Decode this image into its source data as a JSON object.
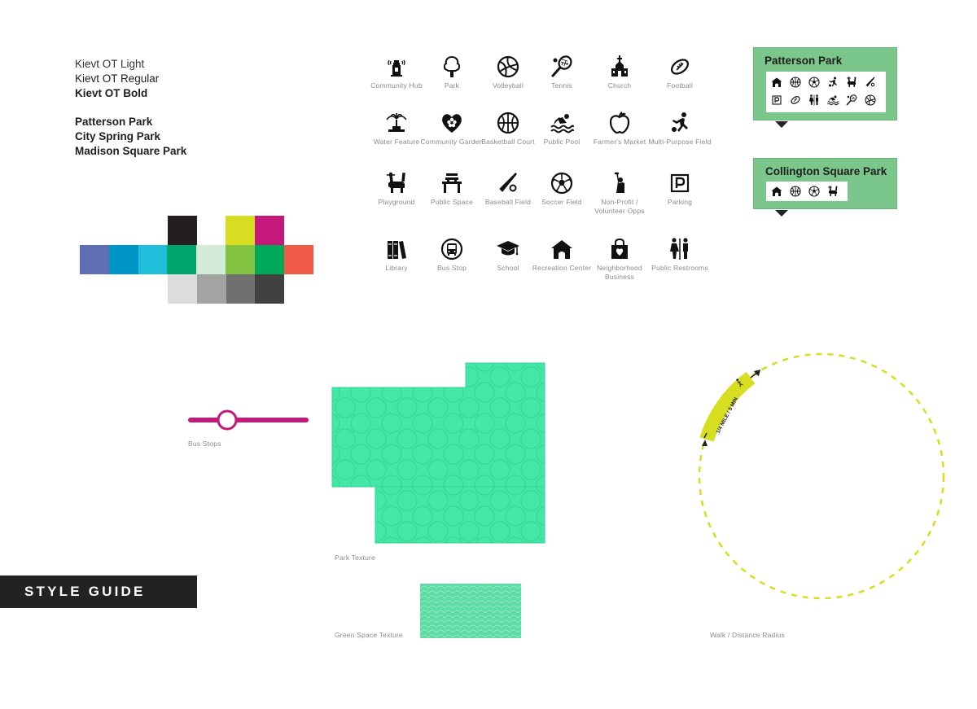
{
  "typography": {
    "light": "Kievt OT Light",
    "regular": "Kievt OT Regular",
    "bold": "Kievt OT Bold"
  },
  "park_names": [
    "Patterson Park",
    "City Spring Park",
    "Madison Square Park"
  ],
  "palette": {
    "row_top": [
      "#231f20",
      "#d7de21",
      "#c4197b"
    ],
    "row_middle": [
      "#5f6db3",
      "#0095c8",
      "#1fbfdc",
      "#00a56d",
      "#d3ead7",
      "#84c341",
      "#00a859",
      "#f15a46"
    ],
    "row_bottom": [
      "#dcdcdc",
      "#a3a3a3",
      "#707070",
      "#414141"
    ]
  },
  "icons": [
    {
      "name": "community-hub-icon",
      "label": "Community Hub"
    },
    {
      "name": "park-icon",
      "label": "Park"
    },
    {
      "name": "volleyball-icon",
      "label": "Volleyball"
    },
    {
      "name": "tennis-icon",
      "label": "Tennis"
    },
    {
      "name": "church-icon",
      "label": "Church"
    },
    {
      "name": "football-icon",
      "label": "Football"
    },
    {
      "name": "water-feature-icon",
      "label": "Water Feature"
    },
    {
      "name": "community-garden-icon",
      "label": "Community Garden"
    },
    {
      "name": "basketball-court-icon",
      "label": "Basketball Court"
    },
    {
      "name": "public-pool-icon",
      "label": "Public Pool"
    },
    {
      "name": "farmers-market-icon",
      "label": "Farmer's Market"
    },
    {
      "name": "multi-purpose-field-icon",
      "label": "Multi-Purpose Field"
    },
    {
      "name": "playground-icon",
      "label": "Playground"
    },
    {
      "name": "public-space-icon",
      "label": "Public Space"
    },
    {
      "name": "baseball-field-icon",
      "label": "Baseball Field"
    },
    {
      "name": "soccer-field-icon",
      "label": "Soccer Field"
    },
    {
      "name": "non-profit-icon",
      "label": "Non-Profit / Volunteer Opps"
    },
    {
      "name": "parking-icon",
      "label": "Parking"
    },
    {
      "name": "library-icon",
      "label": "Library"
    },
    {
      "name": "bus-stop-icon",
      "label": "Bus Stop"
    },
    {
      "name": "school-icon",
      "label": "School"
    },
    {
      "name": "recreation-center-icon",
      "label": "Recreation Center"
    },
    {
      "name": "neighborhood-business-icon",
      "label": "Neighborhood Business"
    },
    {
      "name": "public-restrooms-icon",
      "label": "Public Restrooms"
    }
  ],
  "callouts": {
    "patterson": {
      "title": "Patterson Park",
      "icons": [
        "recreation-center-icon",
        "basketball-icon",
        "soccer-icon",
        "multi-purpose-field-icon",
        "playground-icon",
        "baseball-icon",
        "parking-icon",
        "football-icon",
        "restrooms-icon",
        "pool-icon",
        "tennis-icon",
        "volleyball-icon"
      ]
    },
    "collington": {
      "title": "Collington Square Park",
      "icons": [
        "recreation-center-icon",
        "basketball-icon",
        "soccer-icon",
        "playground-icon"
      ]
    }
  },
  "bus_stop": {
    "label": "Bus Stops",
    "line_color": "#c4197b"
  },
  "park_texture": {
    "label": "Park Texture",
    "color": "#43e8a6"
  },
  "green_space_texture": {
    "label": "Green Space Texture",
    "color": "#5fdca6"
  },
  "walk_radius": {
    "label": "Walk / Distance Radius",
    "tag": "1/4 MILE / 5 MIN",
    "color": "#d7de21"
  },
  "badge": {
    "label": "STYLE GUIDE"
  }
}
